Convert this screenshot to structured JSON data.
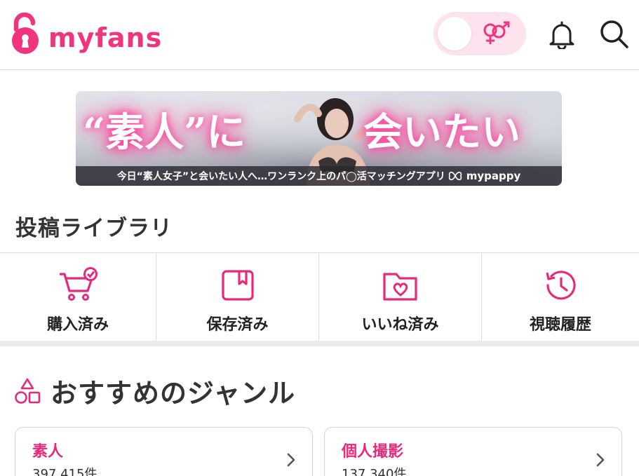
{
  "header": {
    "logo_text": "myfans",
    "brand_color": "#f0347e",
    "icons": [
      "lock-logo-icon",
      "gender-icon",
      "bell-icon",
      "search-icon"
    ]
  },
  "banner": {
    "headline_left": "“素人”に",
    "headline_right": "会いたい",
    "tagline": "今日“素人女子”と会いたい人へ…ワンランク上のパ◯活マッチングアプリ",
    "brand": "mypappy"
  },
  "library": {
    "title": "投稿ライブラリ",
    "items": [
      {
        "label": "購入済み",
        "icon": "cart-check-icon"
      },
      {
        "label": "保存済み",
        "icon": "bookmark-icon"
      },
      {
        "label": "いいね済み",
        "icon": "heart-folder-icon"
      },
      {
        "label": "視聴履歴",
        "icon": "history-icon"
      }
    ]
  },
  "genres": {
    "title": "おすすめのジャンル",
    "cards": [
      {
        "name": "素人",
        "count": "397,415件"
      },
      {
        "name": "個人撮影",
        "count": "137,340件"
      }
    ]
  }
}
